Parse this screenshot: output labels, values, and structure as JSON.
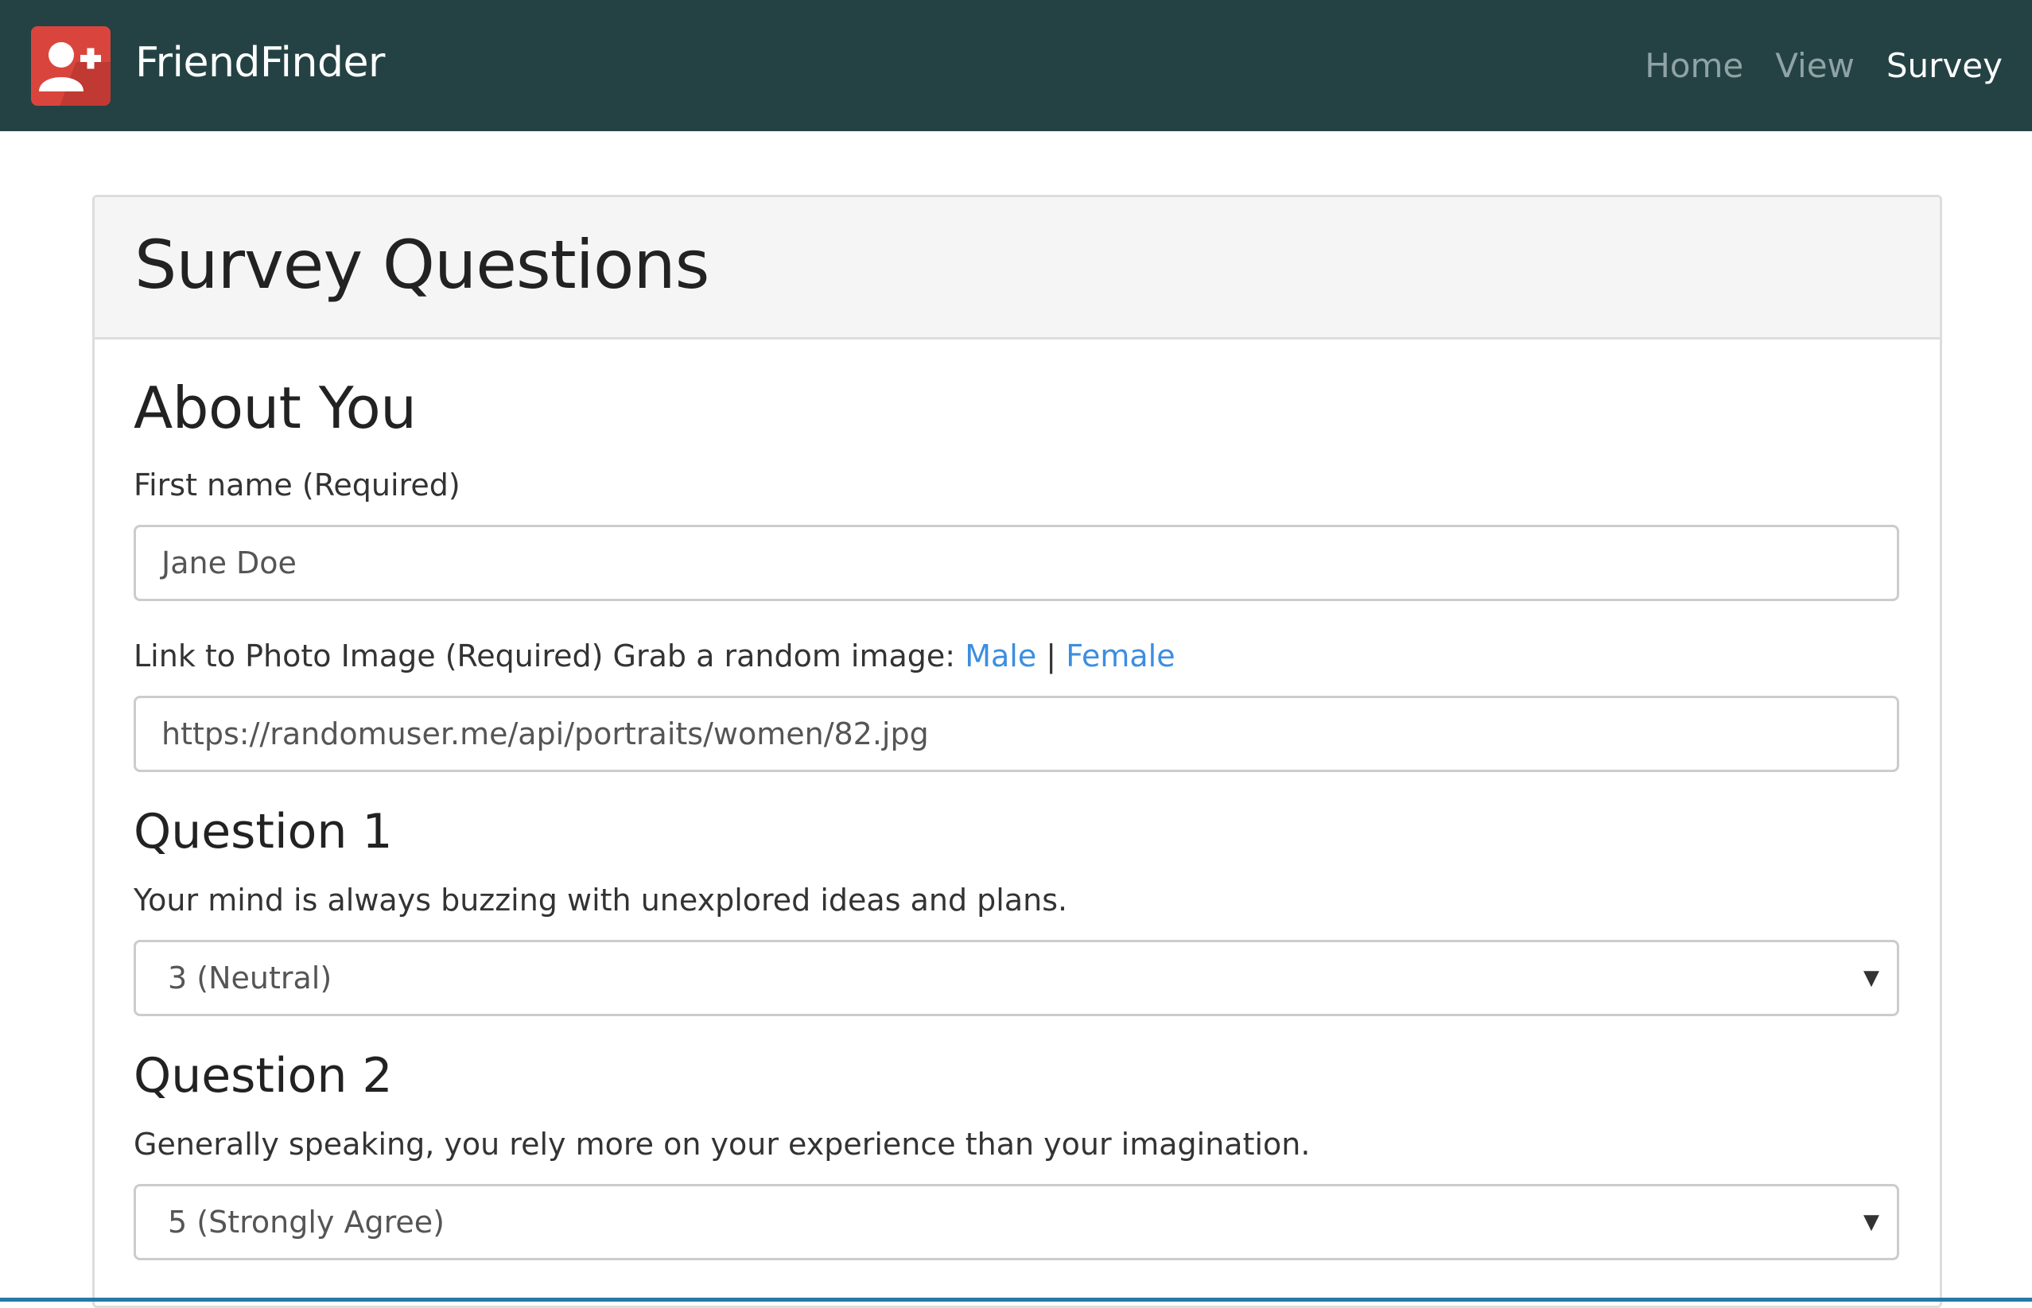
{
  "navbar": {
    "brand": "FriendFinder",
    "links": [
      {
        "label": "Home",
        "active": false
      },
      {
        "label": "View",
        "active": false
      },
      {
        "label": "Survey",
        "active": true
      }
    ]
  },
  "panel": {
    "title": "Survey Questions",
    "about": {
      "heading": "About You",
      "name_label": "First name (Required)",
      "name_value": "Jane Doe",
      "photo_label": "Link to Photo Image (Required) Grab a random image:",
      "photo_link_male": "Male",
      "photo_sep": "|",
      "photo_link_female": "Female",
      "photo_value": "https://randomuser.me/api/portraits/women/82.jpg"
    },
    "questions": [
      {
        "heading": "Question 1",
        "text": "Your mind is always buzzing with unexplored ideas and plans.",
        "selected": "3 (Neutral)"
      },
      {
        "heading": "Question 2",
        "text": "Generally speaking, you rely more on your experience than your imagination.",
        "selected": "5 (Strongly Agree)"
      }
    ]
  },
  "icons": {
    "logo": "add-friend-icon",
    "dropdown": "caret-down-icon"
  },
  "colors": {
    "navbar": "#244244",
    "logo": "#d9453d",
    "link": "#3b8ee0",
    "accent_line": "#2a78a8"
  }
}
